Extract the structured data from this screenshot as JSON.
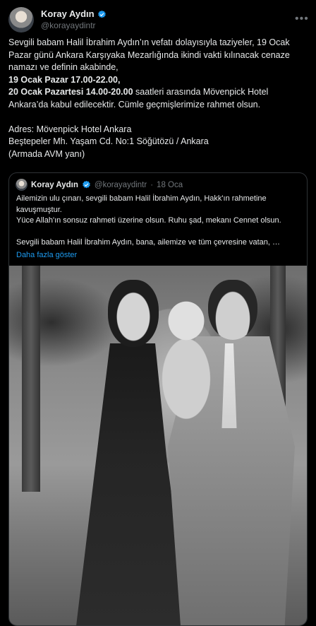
{
  "tweet": {
    "author": {
      "display_name": "Koray Aydın",
      "handle": "@korayaydintr",
      "verified": true
    },
    "text": {
      "line1": "Sevgili babam Halil İbrahim Aydın’ın vefatı dolayısıyla taziyeler, 19 Ocak Pazar günü Ankara Karşıyaka Mezarlığında ikindi vakti kılınacak cenaze namazı ve definin akabinde,",
      "bold1": "19 Ocak Pazar 17.00-22.00,",
      "bold2": "20 Ocak Pazartesi 14.00-20.00",
      "line2_rest": " saatleri arasında Mövenpick Hotel Ankara’da kabul edilecektir. Cümle geçmişlerimize rahmet olsun.",
      "address_label": "Adres: Mövenpick Hotel Ankara",
      "address_line": "Beştepeler Mh. Yaşam Cd. No:1 Söğütözü / Ankara",
      "address_note": "(Armada AVM yanı)"
    },
    "menu_icon": "more-icon"
  },
  "quote": {
    "author": {
      "display_name": "Koray Aydın",
      "handle": "@korayaydintr",
      "verified": true
    },
    "separator": "·",
    "date": "18 Oca",
    "line1": "Ailemizin ulu çınarı, sevgili babam Halil İbrahim Aydın, Hakk'ın rahmetine kavuşmuştur.",
    "line2": "Yüce Allah'ın sonsuz rahmeti üzerine olsun. Ruhu şad, mekanı Cennet olsun.",
    "line3": "Sevgili babam Halil İbrahim Aydın, bana, ailemize ve tüm çevresine vatan, …",
    "show_more": "Daha fazla göster"
  },
  "colors": {
    "background": "#000000",
    "text": "#e7e9ea",
    "muted": "#71767b",
    "link": "#1d9bf0",
    "verified": "#1d9bf0",
    "border": "#2f3336"
  }
}
